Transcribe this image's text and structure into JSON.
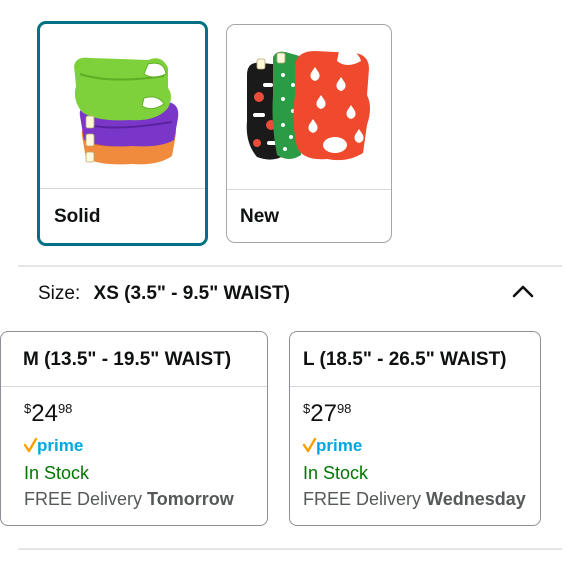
{
  "styles": [
    {
      "label": "Solid",
      "selected": true
    },
    {
      "label": "New",
      "selected": false
    }
  ],
  "size": {
    "label": "Size:",
    "selected": "XS (3.5\" - 9.5\" WAIST)",
    "collapse_icon": "chevron-up-icon"
  },
  "options": [
    {
      "title": "M (13.5\" - 19.5\" WAIST)",
      "price_symbol": "$",
      "price_whole": "24",
      "price_fraction": "98",
      "stock": "In Stock",
      "delivery_prefix": "FREE Delivery",
      "delivery_day": "Tomorrow"
    },
    {
      "title": "L (18.5\" - 26.5\" WAIST)",
      "price_symbol": "$",
      "price_whole": "27",
      "price_fraction": "98",
      "stock": "In Stock",
      "delivery_prefix": "FREE Delivery",
      "delivery_day": "Wednesday"
    }
  ],
  "colors": {
    "selected_border": "#007185",
    "stock_green": "#007600",
    "prime_blue": "#00a8e1",
    "prime_check": "#f7a200"
  }
}
